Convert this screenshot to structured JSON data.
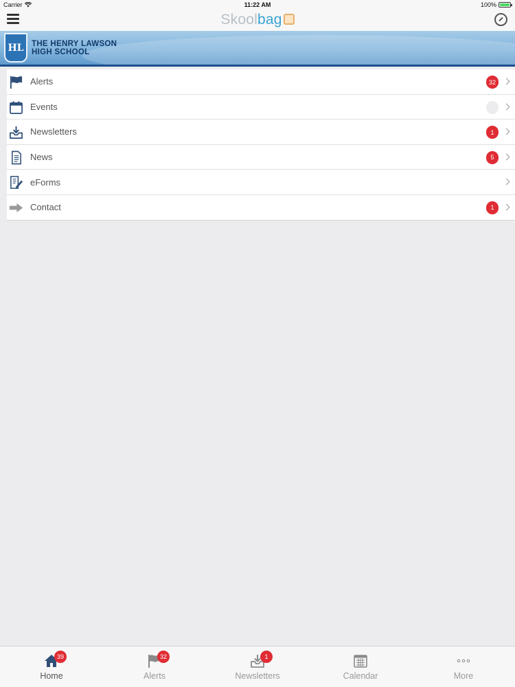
{
  "status_bar": {
    "carrier": "Carrier",
    "time": "11:22 AM",
    "battery": "100%"
  },
  "nav": {
    "logo_part1": "Skool",
    "logo_part2": "bag"
  },
  "banner": {
    "school_line1": "THE HENRY LAWSON",
    "school_line2": "HIGH SCHOOL",
    "crest_letters": "HL"
  },
  "menu": [
    {
      "label": "Alerts",
      "icon": "flag-icon",
      "badge": "32"
    },
    {
      "label": "Events",
      "icon": "calendar-icon",
      "badge": ""
    },
    {
      "label": "Newsletters",
      "icon": "inbox-download-icon",
      "badge": "1"
    },
    {
      "label": "News",
      "icon": "document-icon",
      "badge": "5"
    },
    {
      "label": "eForms",
      "icon": "form-edit-icon",
      "badge": null
    },
    {
      "label": "Contact",
      "icon": "arrow-right-icon",
      "badge": "1"
    }
  ],
  "tabs": [
    {
      "label": "Home",
      "icon": "home-icon",
      "badge": "39"
    },
    {
      "label": "Alerts",
      "icon": "flag-icon",
      "badge": "32"
    },
    {
      "label": "Newsletters",
      "icon": "inbox-download-icon",
      "badge": "1"
    },
    {
      "label": "Calendar",
      "icon": "calendar-icon",
      "badge": null
    },
    {
      "label": "More",
      "icon": "more-dots-icon",
      "badge": null
    }
  ],
  "colors": {
    "badge_red": "#e02c34",
    "banner_blue": "#7fb3dc",
    "brand_blue": "#3aa3d4"
  }
}
